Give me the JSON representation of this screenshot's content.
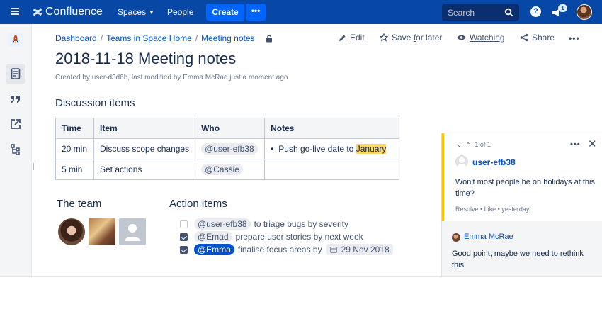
{
  "nav": {
    "brand": "Confluence",
    "spaces": "Spaces",
    "people": "People",
    "create": "Create",
    "more": "•••",
    "search_placeholder": "Search",
    "help": "?",
    "notifications_count": "1"
  },
  "breadcrumbs": [
    "Dashboard",
    "Teams in Space Home",
    "Meeting notes"
  ],
  "page_actions": {
    "edit": "Edit",
    "save_pre": "Save ",
    "save_u": "f",
    "save_post": "or later",
    "watching": "Watching",
    "share": "Share",
    "more": "•••"
  },
  "page": {
    "title": "2018-11-18 Meeting notes",
    "byline": "Created by user-d3d6b, last modified by Emma McRae just a moment ago"
  },
  "discussion": {
    "heading": "Discussion items",
    "columns": [
      "Time",
      "Item",
      "Who",
      "Notes"
    ],
    "rows": [
      {
        "time": "20 min",
        "item": "Discuss scope changes",
        "who": "@user-efb38",
        "note_pre": "Push go-live date to ",
        "note_highlight": "January"
      },
      {
        "time": "5 min",
        "item": "Set actions",
        "who": "@Cassie",
        "note_pre": "",
        "note_highlight": ""
      }
    ]
  },
  "team": {
    "heading": "The team",
    "members": [
      "avatar-photo-woman",
      "avatar-photo-portrait",
      "avatar-default-placeholder"
    ]
  },
  "action_items": {
    "heading": "Action items",
    "tasks": [
      {
        "checked": false,
        "mention": "@user-efb38",
        "text": "to triage bugs by severity",
        "date": ""
      },
      {
        "checked": true,
        "mention": "@Emad",
        "text": "prepare user stories by next week",
        "date": ""
      },
      {
        "checked": true,
        "mention": "@Emma",
        "text": "finalise focus areas by",
        "date": "29 Nov 2018"
      }
    ]
  },
  "comments": {
    "counter": "1 of 1",
    "more": "•••",
    "close": "✕",
    "main": {
      "author": "user-efb38",
      "text": "Won't most people be on holidays at this time?",
      "meta": "Resolve • Like • yesterday"
    },
    "reply": {
      "author": "Emma McRae",
      "text": "Good point, maybe we need to rethink this"
    }
  },
  "colors": {
    "nav_bg": "#0747a6",
    "create_button": "#0065ff",
    "link": "#0052cc",
    "highlight": "#fcd56b",
    "comment_accent": "#ffc400",
    "mention_self": "#0052cc"
  }
}
